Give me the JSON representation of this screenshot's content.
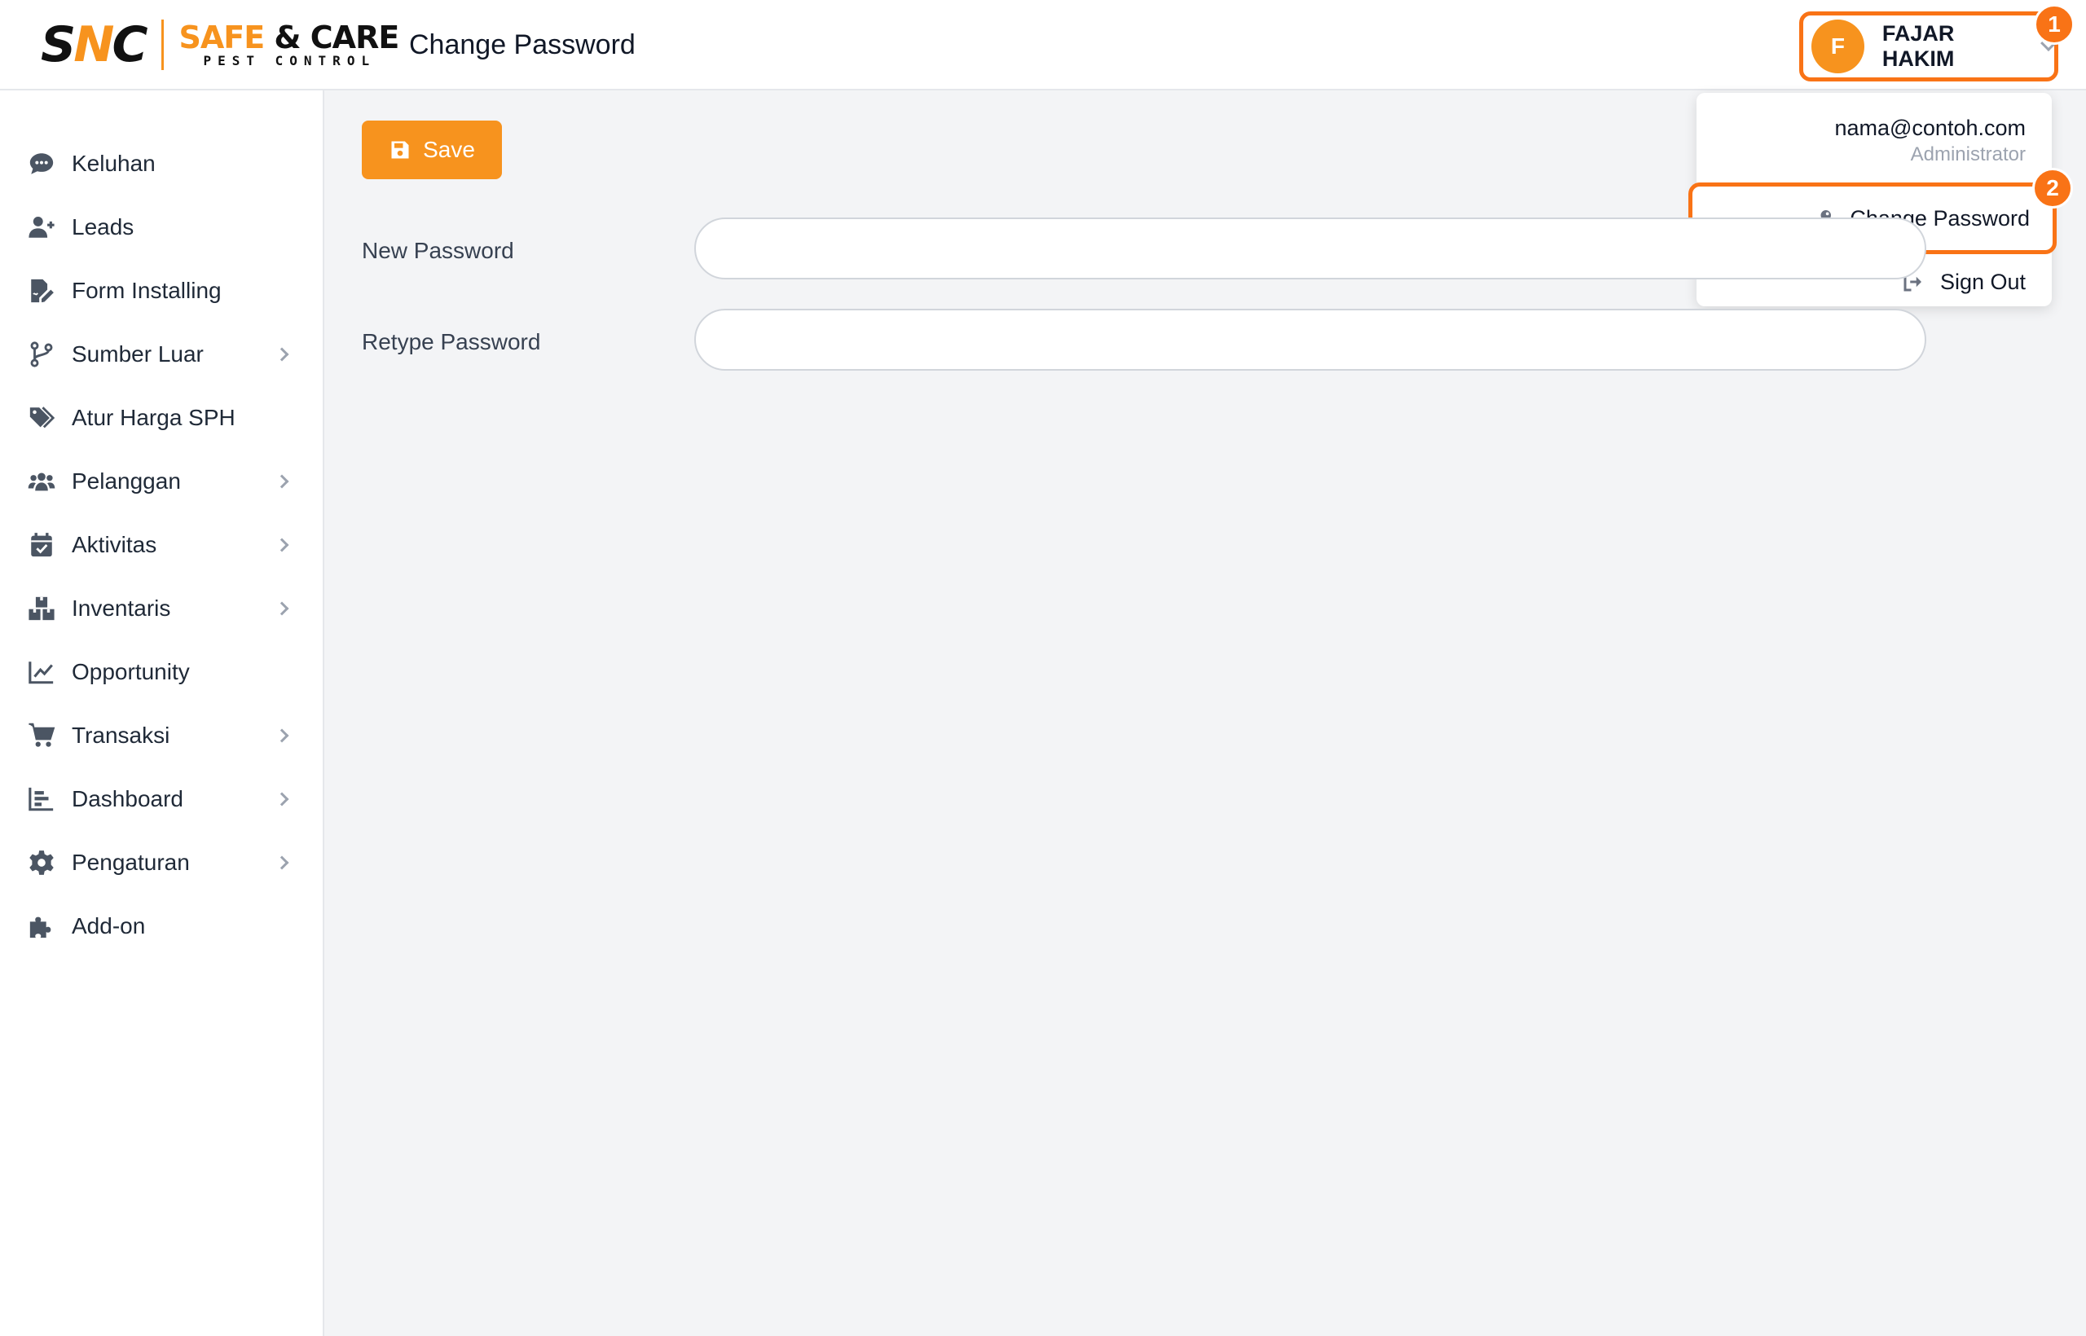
{
  "brand": {
    "mark": "SNC",
    "name_line1_a": "SAFE",
    "name_line1_b": " & CARE",
    "name_line2": "PEST CONTROL"
  },
  "header": {
    "title": "Change Password"
  },
  "user": {
    "initial": "F",
    "name": "FAJAR HAKIM",
    "email": "nama@contoh.com",
    "role": "Administrator"
  },
  "badges": {
    "one": "1",
    "two": "2"
  },
  "dropdown": {
    "change_password": "Change Password",
    "sign_out": "Sign Out"
  },
  "sidebar": {
    "items": [
      {
        "label": "Keluhan",
        "icon": "comment-dots-icon",
        "has_children": false
      },
      {
        "label": "Leads",
        "icon": "user-plus-icon",
        "has_children": false
      },
      {
        "label": "Form Installing",
        "icon": "file-signature-icon",
        "has_children": false
      },
      {
        "label": "Sumber Luar",
        "icon": "code-branch-icon",
        "has_children": true
      },
      {
        "label": "Atur Harga SPH",
        "icon": "tags-icon",
        "has_children": false
      },
      {
        "label": "Pelanggan",
        "icon": "users-icon",
        "has_children": true
      },
      {
        "label": "Aktivitas",
        "icon": "calendar-check-icon",
        "has_children": true
      },
      {
        "label": "Inventaris",
        "icon": "boxes-icon",
        "has_children": true
      },
      {
        "label": "Opportunity",
        "icon": "chart-line-icon",
        "has_children": false
      },
      {
        "label": "Transaksi",
        "icon": "shopping-cart-icon",
        "has_children": true
      },
      {
        "label": "Dashboard",
        "icon": "chart-bar-icon",
        "has_children": true
      },
      {
        "label": "Pengaturan",
        "icon": "cog-icon",
        "has_children": true
      },
      {
        "label": "Add-on",
        "icon": "puzzle-piece-icon",
        "has_children": false
      }
    ]
  },
  "toolbar": {
    "save_label": "Save"
  },
  "form": {
    "new_password_label": "New Password",
    "new_password_value": "",
    "retype_password_label": "Retype Password",
    "retype_password_value": ""
  },
  "colors": {
    "brand_orange": "#f7931e",
    "highlight_orange": "#f97316",
    "icon_gray": "#4b5563"
  }
}
